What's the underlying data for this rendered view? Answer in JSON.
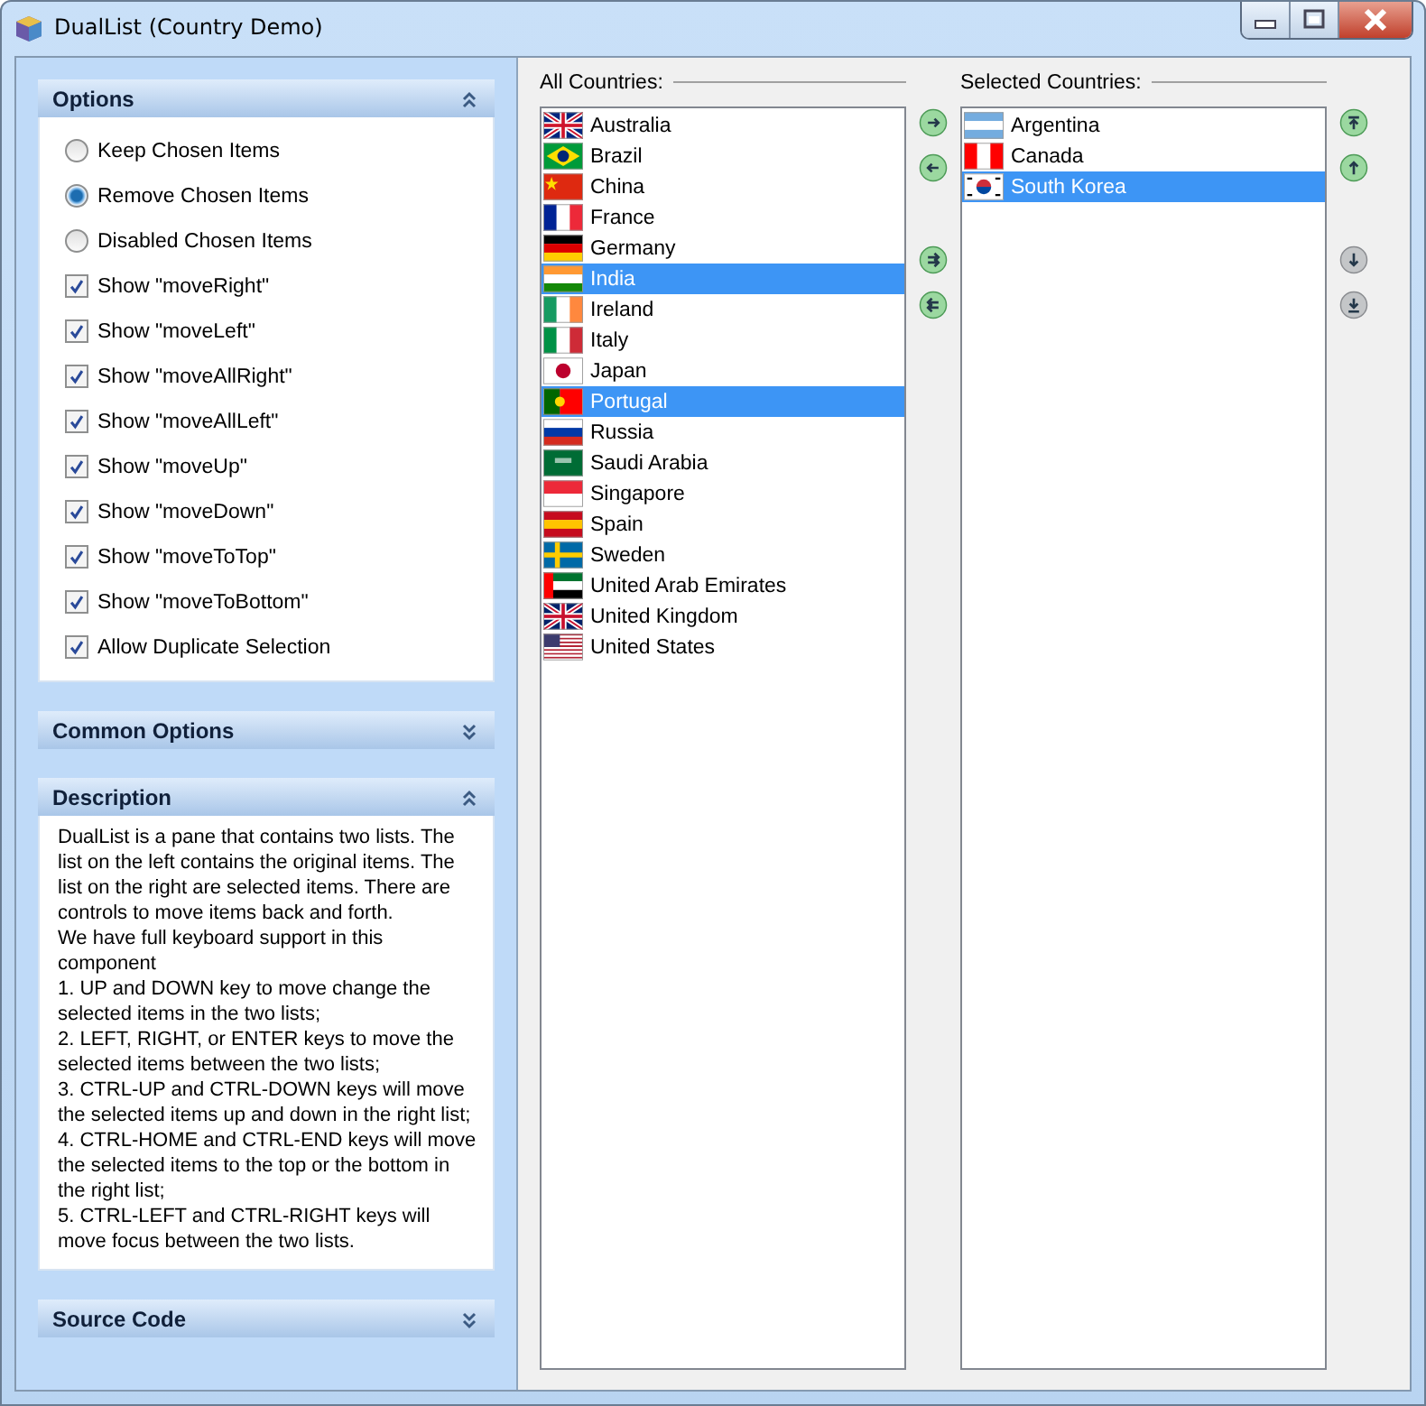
{
  "window": {
    "title": "DualList (Country Demo)"
  },
  "panels": [
    {
      "title": "Options",
      "expanded": true,
      "kind": "options",
      "options": [
        {
          "kind": "radio",
          "label": "Keep Chosen Items",
          "selected": false
        },
        {
          "kind": "radio",
          "label": "Remove Chosen Items",
          "selected": true
        },
        {
          "kind": "radio",
          "label": "Disabled Chosen Items",
          "selected": false
        },
        {
          "kind": "checkbox",
          "label": "Show \"moveRight\"",
          "checked": true
        },
        {
          "kind": "checkbox",
          "label": "Show \"moveLeft\"",
          "checked": true
        },
        {
          "kind": "checkbox",
          "label": "Show \"moveAllRight\"",
          "checked": true
        },
        {
          "kind": "checkbox",
          "label": "Show \"moveAllLeft\"",
          "checked": true
        },
        {
          "kind": "checkbox",
          "label": "Show \"moveUp\"",
          "checked": true
        },
        {
          "kind": "checkbox",
          "label": "Show \"moveDown\"",
          "checked": true
        },
        {
          "kind": "checkbox",
          "label": "Show \"moveToTop\"",
          "checked": true
        },
        {
          "kind": "checkbox",
          "label": "Show \"moveToBottom\"",
          "checked": true
        },
        {
          "kind": "checkbox",
          "label": "Allow Duplicate Selection",
          "checked": true
        }
      ]
    },
    {
      "title": "Common Options",
      "expanded": false
    },
    {
      "title": "Description",
      "expanded": true,
      "kind": "text",
      "text": "DualList is a pane that contains two lists. The list on the left contains the original items. The list on the right are selected items. There are controls to move items back and forth.\nWe have full keyboard support in this component\n1. UP and DOWN key to move change the selected items in the two lists;\n2. LEFT, RIGHT, or ENTER keys to move the selected items between the two lists;\n3. CTRL-UP and CTRL-DOWN keys will move the selected items up and down in the right list;\n4. CTRL-HOME and CTRL-END keys will move the selected items to the top or the bottom in the right list;\n5. CTRL-LEFT and CTRL-RIGHT keys will move focus between the two lists."
    },
    {
      "title": "Source Code",
      "expanded": false
    }
  ],
  "all_list": {
    "title": "All Countries:",
    "items": [
      {
        "label": "Australia",
        "selected": false,
        "kind": "au"
      },
      {
        "label": "Brazil",
        "selected": false,
        "kind": "br"
      },
      {
        "label": "China",
        "selected": false,
        "kind": "cn"
      },
      {
        "label": "France",
        "selected": false,
        "kind": "fr"
      },
      {
        "label": "Germany",
        "selected": false,
        "kind": "de"
      },
      {
        "label": "India",
        "selected": true,
        "kind": "in"
      },
      {
        "label": "Ireland",
        "selected": false,
        "kind": "ie"
      },
      {
        "label": "Italy",
        "selected": false,
        "kind": "it"
      },
      {
        "label": "Japan",
        "selected": false,
        "kind": "jp"
      },
      {
        "label": "Portugal",
        "selected": true,
        "kind": "pt"
      },
      {
        "label": "Russia",
        "selected": false,
        "kind": "ru"
      },
      {
        "label": "Saudi Arabia",
        "selected": false,
        "kind": "sa"
      },
      {
        "label": "Singapore",
        "selected": false,
        "kind": "sg"
      },
      {
        "label": "Spain",
        "selected": false,
        "kind": "es"
      },
      {
        "label": "Sweden",
        "selected": false,
        "kind": "se"
      },
      {
        "label": "United Arab Emirates",
        "selected": false,
        "kind": "ae"
      },
      {
        "label": "United Kingdom",
        "selected": false,
        "kind": "gb"
      },
      {
        "label": "United States",
        "selected": false,
        "kind": "us"
      }
    ]
  },
  "move_buttons": [
    {
      "kind": "right",
      "disabled": false
    },
    {
      "kind": "left",
      "disabled": false
    },
    {
      "kind": "gap"
    },
    {
      "kind": "all-right",
      "disabled": false
    },
    {
      "kind": "all-left",
      "disabled": false
    }
  ],
  "selected_list": {
    "title": "Selected Countries:",
    "items": [
      {
        "label": "Argentina",
        "selected": false,
        "kind": "ar"
      },
      {
        "label": "Canada",
        "selected": false,
        "kind": "ca"
      },
      {
        "label": "South Korea",
        "selected": true,
        "kind": "kr"
      }
    ]
  },
  "order_buttons": [
    {
      "kind": "top",
      "disabled": false
    },
    {
      "kind": "up",
      "disabled": false
    },
    {
      "kind": "gap"
    },
    {
      "kind": "down",
      "disabled": true
    },
    {
      "kind": "bottom",
      "disabled": true
    }
  ]
}
